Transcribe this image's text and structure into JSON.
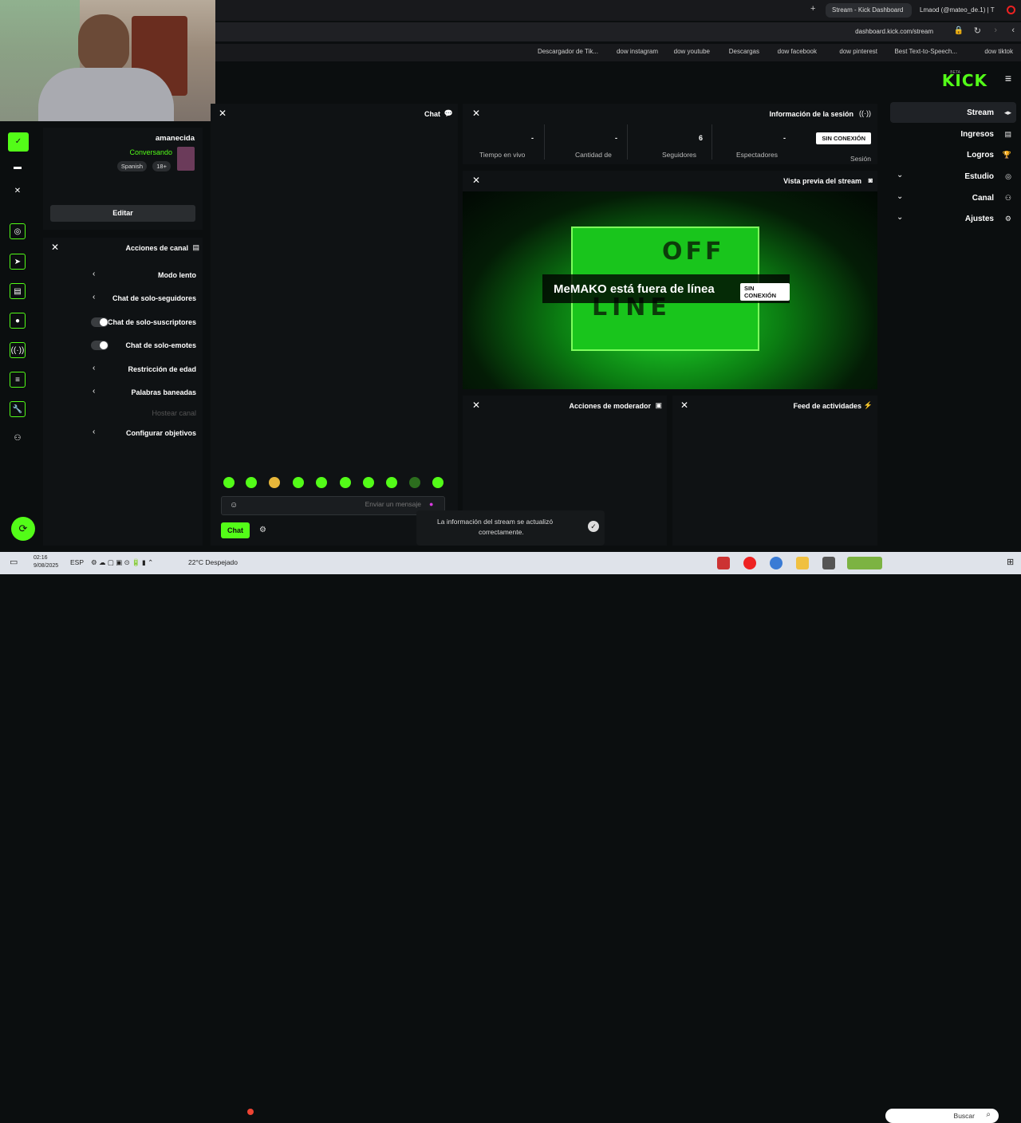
{
  "browser": {
    "tabs": [
      {
        "label": "Stream - Kick Dashboard"
      },
      {
        "label": "Lmaod (@mateo_de.1) | T"
      }
    ],
    "url": "dashboard.kick.com/stream",
    "bookmarks": [
      "dow tiktok",
      "Best Text-to-Speech...",
      "dow pinterest",
      "dow facebook",
      "Descargas",
      "dow youtube",
      "dow instagram",
      "Descargador de Tik..."
    ]
  },
  "header": {
    "logo": "KICK",
    "beta": "BETA"
  },
  "sidebar": {
    "items": [
      {
        "label": "Stream"
      },
      {
        "label": "Ingresos"
      },
      {
        "label": "Logros"
      },
      {
        "label": "Estudio"
      },
      {
        "label": "Canal"
      },
      {
        "label": "Ajustes"
      }
    ]
  },
  "session": {
    "title": "Información de la sesión",
    "badge": "SIN CONEXIÓN",
    "session_label": "Sesión",
    "stats": [
      {
        "value": "-",
        "label": "Espectadores"
      },
      {
        "value": "6",
        "label": "Seguidores"
      },
      {
        "value": "-",
        "label": "Cantidad de"
      },
      {
        "value": "-",
        "label": "Tiempo en vivo"
      }
    ]
  },
  "preview": {
    "title": "Vista previa del stream",
    "offline_text": "MeMAKO está fuera de línea",
    "badge": "SIN CONEXIÓN",
    "sign_top": "OFF",
    "sign_bottom": "LINE"
  },
  "moderator": {
    "title": "Acciones de moderador"
  },
  "activity": {
    "title": "Feed de actividades"
  },
  "chat": {
    "title": "Chat",
    "placeholder": "Enviar un mensaje",
    "send_label": "Chat"
  },
  "toast": {
    "text_line1": "La información del stream se actualizó",
    "text_line2": "correctamente."
  },
  "stream_info": {
    "title": "amanecida",
    "category": "Conversando",
    "tags": [
      "18+",
      "Spanish"
    ],
    "edit_label": "Editar"
  },
  "channel_actions": {
    "title": "Acciones de canal",
    "items": [
      {
        "label": "Modo lento",
        "control": "chevron"
      },
      {
        "label": "Chat de solo-seguidores",
        "control": "chevron"
      },
      {
        "label": "Chat de solo-suscriptores",
        "control": "toggle"
      },
      {
        "label": "Chat de solo-emotes",
        "control": "toggle"
      },
      {
        "label": "Restricción de edad",
        "control": "chevron"
      },
      {
        "label": "Palabras baneadas",
        "control": "chevron"
      },
      {
        "label": "Hostear canal",
        "control": "none"
      },
      {
        "label": "Configurar objetivos",
        "control": "chevron"
      }
    ]
  },
  "taskbar": {
    "search": "Buscar",
    "weather": "22°C Despejado",
    "language": "ESP",
    "time": "02:16",
    "date": "9/08/2025"
  },
  "colors": {
    "accent": "#53fc18",
    "bg": "#0b0e0f",
    "panel": "#0f1214"
  }
}
